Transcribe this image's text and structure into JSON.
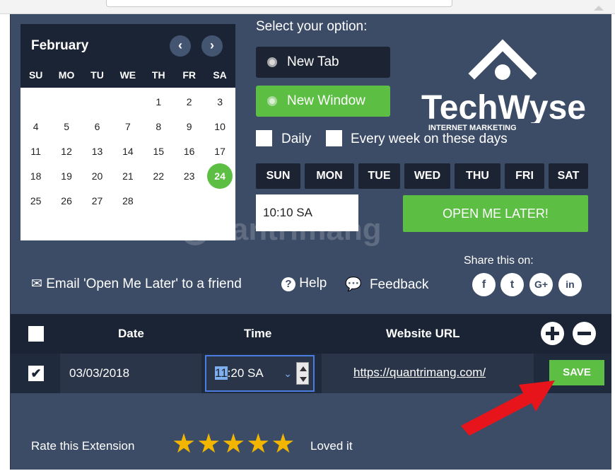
{
  "calendar": {
    "month": "February",
    "prev_icon": "chevron-left-icon",
    "next_icon": "chevron-right-icon",
    "weekdays": [
      "SU",
      "MO",
      "TU",
      "WE",
      "TH",
      "FR",
      "SA"
    ],
    "weeks": [
      [
        "",
        "",
        "",
        "",
        "1",
        "2",
        "3"
      ],
      [
        "4",
        "5",
        "6",
        "7",
        "8",
        "9",
        "10"
      ],
      [
        "11",
        "12",
        "13",
        "14",
        "15",
        "16",
        "17"
      ],
      [
        "18",
        "19",
        "20",
        "21",
        "22",
        "23",
        "24"
      ],
      [
        "25",
        "26",
        "27",
        "28",
        "",
        "",
        ""
      ]
    ],
    "selected_day": "24",
    "accent": "#5cbf43"
  },
  "options": {
    "title": "Select your option:",
    "new_tab": "New Tab",
    "new_window": "New Window",
    "daily": "Daily",
    "every_week": "Every week on these days",
    "days": [
      "SUN",
      "MON",
      "TUE",
      "WED",
      "THU",
      "FRI",
      "SAT"
    ],
    "time_value": "10:10 SA",
    "open_later": "OPEN ME LATER!"
  },
  "logo": {
    "brand": "TechWyse",
    "tagline": "INTERNET MARKETING"
  },
  "watermark": "uantrimang",
  "links": {
    "email": "Email 'Open Me Later' to a friend",
    "help": "Help",
    "feedback": "Feedback",
    "share_label": "Share this on:"
  },
  "table": {
    "headers": {
      "date": "Date",
      "time": "Time",
      "url": "Website URL"
    },
    "row": {
      "date": "03/03/2018",
      "time_hour": "11",
      "time_rest": ":20 SA",
      "url": "https://quantrimang.com/",
      "save": "SAVE"
    }
  },
  "rating": {
    "label": "Rate this Extension",
    "stars": 5,
    "loved": "Loved it"
  },
  "colors": {
    "panel": "#3c4c66",
    "dark": "#1b2434",
    "green": "#5cbf43",
    "star": "#f2b500",
    "arrow": "#e8141c"
  }
}
